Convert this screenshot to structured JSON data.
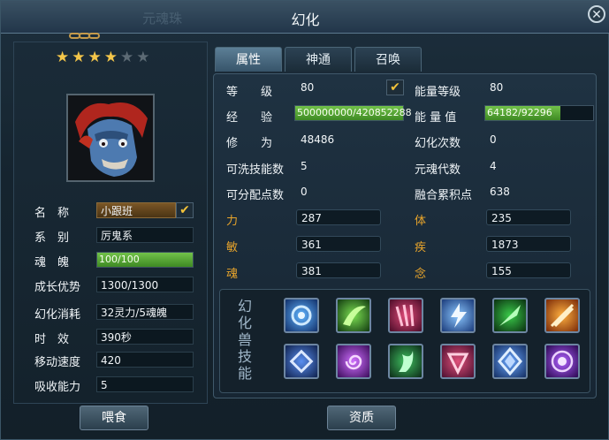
{
  "window": {
    "title": "幻化",
    "ghost_title": "元魂珠",
    "close_icon": "close-icon"
  },
  "stars": {
    "rating": 4,
    "max": 5
  },
  "left": {
    "name_label": "名　称",
    "name_value": "小跟班",
    "series_label": "系　别",
    "series_value": "厉鬼系",
    "soul_label": "魂　魄",
    "soul_value": "100/100",
    "soul_fraction": 1.0,
    "growth_label": "成长优势",
    "growth_value": "1300/1300",
    "cost_label": "幻化消耗",
    "cost_value": "32灵力/5魂魄",
    "duration_label": "时　效",
    "duration_value": "390秒",
    "speed_label": "移动速度",
    "speed_value": "420",
    "absorb_label": "吸收能力",
    "absorb_value": "5"
  },
  "tabs": [
    {
      "label": "属性",
      "active": true
    },
    {
      "label": "神通",
      "active": false
    },
    {
      "label": "召唤",
      "active": false
    }
  ],
  "stats": {
    "level_label": "等　　级",
    "level_value": "80",
    "exp_label": "经　　验",
    "exp_value": "500000000/420852288",
    "exp_fraction": 1.0,
    "cultivation_label": "修　　为",
    "cultivation_value": "48486",
    "washable_label": "可洗技能数",
    "washable_value": "5",
    "assignable_label": "可分配点数",
    "assignable_value": "0",
    "energy_level_label": "能量等级",
    "energy_level_value": "80",
    "energy_label": "能 量 值",
    "energy_value": "64182/92296",
    "energy_fraction": 0.695,
    "transform_count_label": "幻化次数",
    "transform_count_value": "0",
    "soul_generation_label": "元魂代数",
    "soul_generation_value": "4",
    "fusion_label": "融合累积点",
    "fusion_value": "638"
  },
  "attributes": [
    {
      "label": "力",
      "value": "287"
    },
    {
      "label": "体",
      "value": "235"
    },
    {
      "label": "敏",
      "value": "361"
    },
    {
      "label": "疾",
      "value": "1873"
    },
    {
      "label": "魂",
      "value": "381"
    },
    {
      "label": "念",
      "value": "155"
    }
  ],
  "skills": {
    "title": "幻化兽技能",
    "icons": [
      "blue-vortex-icon",
      "green-wind-icon",
      "red-claw-icon",
      "blue-lightning-icon",
      "green-slash-icon",
      "orange-blade-icon",
      "blue-rune-icon",
      "purple-spiral-icon",
      "green-energy-icon",
      "red-rune-icon",
      "blue-crystal-icon",
      "purple-orb-icon"
    ]
  },
  "buttons": {
    "feed": "喂食",
    "aptitude": "资质"
  },
  "colors": {
    "attribute_label": "#e9a52b",
    "bar_green": "#5aa83a",
    "star_gold": "#f4c64a",
    "check_gold": "#f2c23a"
  }
}
